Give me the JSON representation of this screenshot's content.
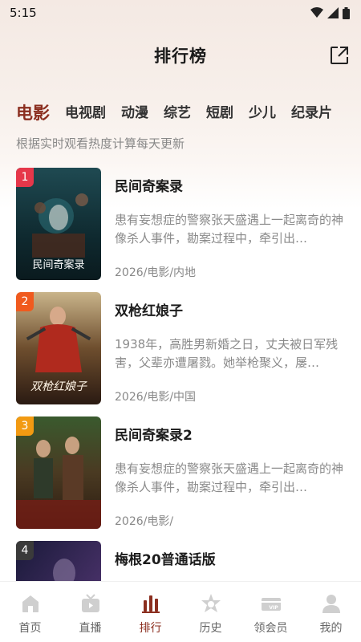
{
  "status": {
    "time": "5:15"
  },
  "header": {
    "title": "排行榜"
  },
  "tabs": [
    {
      "label": "电影",
      "active": true
    },
    {
      "label": "电视剧"
    },
    {
      "label": "动漫"
    },
    {
      "label": "综艺"
    },
    {
      "label": "短剧"
    },
    {
      "label": "少儿"
    },
    {
      "label": "纪录片"
    }
  ],
  "subtitle": "根据实时观看热度计算每天更新",
  "items": [
    {
      "rank": "1",
      "rank_color": "#e6374a",
      "title": "民间奇案录",
      "desc": "患有妄想症的警察张天盛遇上一起离奇的神像杀人事件，勘案过程中，牵引出…",
      "meta": "2026/电影/内地",
      "poster_text": "民间奇案录"
    },
    {
      "rank": "2",
      "rank_color": "#f05a1e",
      "title": "双枪红娘子",
      "desc": "1938年，高胜男新婚之日，丈夫被日军残害，父辈亦遭屠戮。她举枪聚义，屡…",
      "meta": "2026/电影/中国",
      "poster_text": "双枪红娘子"
    },
    {
      "rank": "3",
      "rank_color": "#f29a12",
      "title": "民间奇案录2",
      "desc": "患有妄想症的警察张天盛遇上一起离奇的神像杀人事件，勘案过程中，牵引出…",
      "meta": "2026/电影/",
      "poster_text": ""
    },
    {
      "rank": "4",
      "rank_color": "#3a3a3a",
      "title": "梅根20普通话版",
      "desc": "",
      "meta": "",
      "poster_text": ""
    }
  ],
  "nav": [
    {
      "label": "首页",
      "icon": "home-icon"
    },
    {
      "label": "直播",
      "icon": "tv-icon"
    },
    {
      "label": "排行",
      "icon": "ranking-icon",
      "active": true
    },
    {
      "label": "历史",
      "icon": "history-icon"
    },
    {
      "label": "领会员",
      "icon": "vip-icon"
    },
    {
      "label": "我的",
      "icon": "profile-icon"
    }
  ],
  "colors": {
    "accent": "#8b2e1f"
  }
}
